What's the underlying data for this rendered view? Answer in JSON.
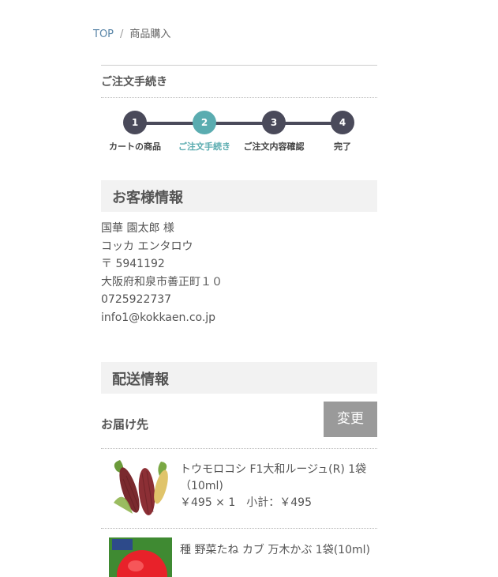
{
  "breadcrumb": {
    "home": "TOP",
    "sep": "/",
    "current": "商品購入"
  },
  "order": {
    "title": "ご注文手続き"
  },
  "steps": [
    {
      "num": "1",
      "label": "カートの商品"
    },
    {
      "num": "2",
      "label": "ご注文手続き"
    },
    {
      "num": "3",
      "label": "ご注文内容確認"
    },
    {
      "num": "4",
      "label": "完了"
    }
  ],
  "customer": {
    "heading": "お客様情報",
    "name": "国華 園太郎 様",
    "kana": "コッカ エンタロウ",
    "postal": "〒 5941192",
    "address": "大阪府和泉市善正町１０",
    "phone": "0725922737",
    "email": "info1@kokkaen.co.jp"
  },
  "shipping": {
    "heading": "配送情報",
    "dest_label": "お届け先",
    "change_button": "変更"
  },
  "items": [
    {
      "name": "トウモロコシ F1大和ルージュ(R) 1袋（10ml)",
      "price": "￥495 × 1　小計：￥495"
    },
    {
      "name": "種 野菜たね カブ 万木かぶ 1袋(10ml)",
      "price": ""
    }
  ],
  "colors": {
    "step_active": "#5aacb0",
    "step_default": "#4a4a5a",
    "button": "#9a9a9a"
  }
}
